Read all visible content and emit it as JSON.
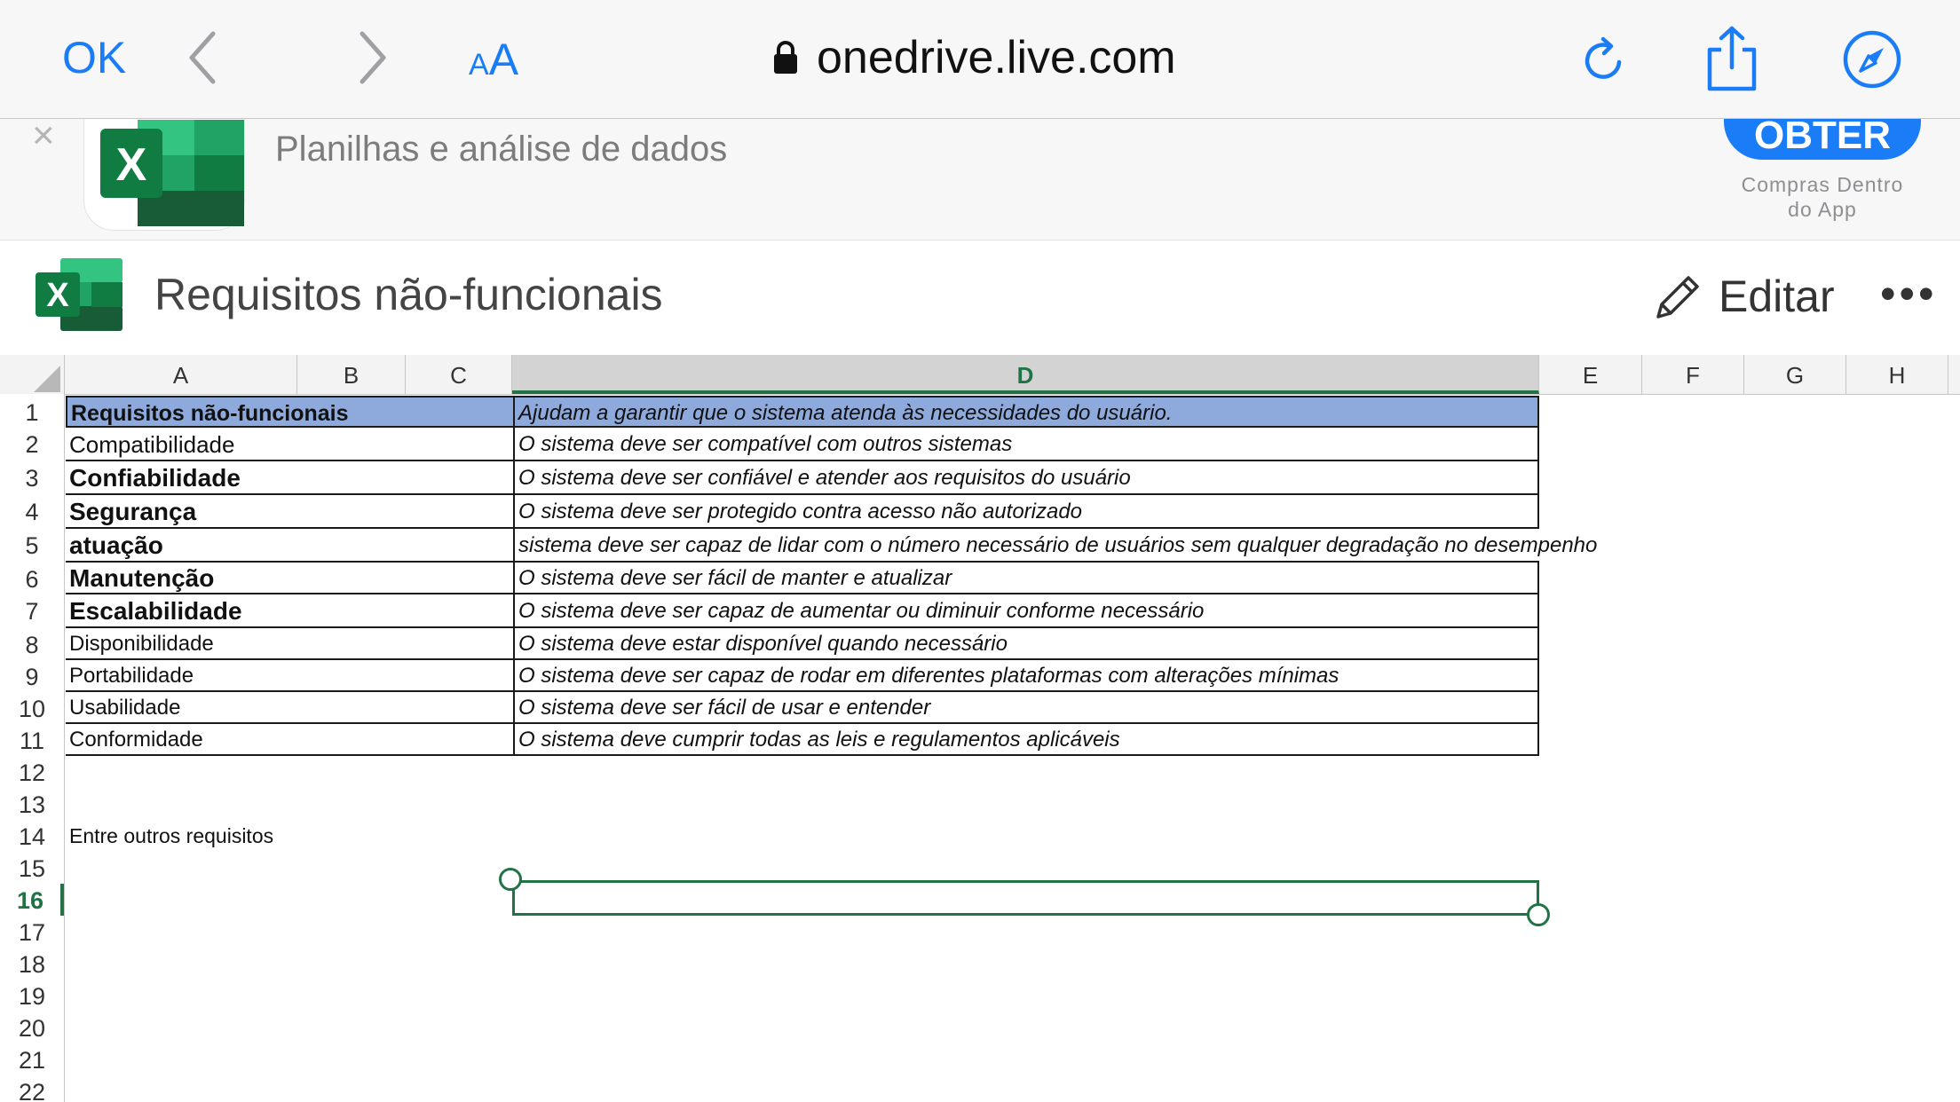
{
  "browser": {
    "ok_label": "OK",
    "aa_small": "A",
    "aa_big": "A",
    "url": "onedrive.live.com"
  },
  "banner": {
    "close": "×",
    "subtitle": "Planilhas e análise de dados",
    "get_label": "OBTER",
    "iap_line1": "Compras Dentro",
    "iap_line2": "do App"
  },
  "document": {
    "title": "Requisitos não-funcionais",
    "edit_label": "Editar",
    "more": "•••"
  },
  "sheet": {
    "columns": [
      "A",
      "B",
      "C",
      "D",
      "E",
      "F",
      "G",
      "H"
    ],
    "active_column": "D",
    "rows": [
      "1",
      "2",
      "3",
      "4",
      "5",
      "6",
      "7",
      "8",
      "9",
      "10",
      "11",
      "12",
      "13",
      "14",
      "15",
      "16",
      "17",
      "18",
      "19",
      "20",
      "21",
      "22"
    ],
    "active_row": "16",
    "cells": {
      "A1": "Requisitos não-funcionais",
      "D1": "Ajudam a garantir que o sistema atenda às necessidades do usuário.",
      "A2": "Compatibilidade",
      "D2": "O sistema deve ser compatível com outros sistemas",
      "A3": "Confiabilidade",
      "D3": "O sistema deve ser confiável e atender aos requisitos do usuário",
      "A4": "Segurança",
      "D4": "O sistema deve ser protegido contra acesso não autorizado",
      "A5": "atuação",
      "D5": "sistema deve ser capaz de lidar com o número necessário de usuários sem qualquer degradação no desempenho",
      "A6": "Manutenção",
      "D6": "O sistema deve ser fácil de manter e atualizar",
      "A7": "Escalabilidade",
      "D7": "O sistema deve ser capaz de aumentar ou diminuir conforme necessário",
      "A8": "Disponibilidade",
      "D8": "O sistema deve estar disponível quando necessário",
      "A9": "Portabilidade",
      "D9": "O sistema deve ser capaz de rodar em diferentes plataformas com alterações mínimas",
      "A10": "Usabilidade",
      "D10": "O sistema deve ser fácil de usar e entender",
      "A11": "Conformidade",
      "D11": "O sistema deve cumprir todas as leis e regulamentos aplicáveis",
      "A14": "Entre outros requisitos"
    }
  },
  "colors": {
    "ios_blue": "#1a7cf6",
    "excel_green": "#217346",
    "header_fill": "#8ea9db"
  },
  "icons": [
    "back-chevron-icon",
    "forward-chevron-icon",
    "lock-icon",
    "reload-icon",
    "share-icon",
    "compass-icon",
    "excel-icon",
    "pencil-icon"
  ]
}
